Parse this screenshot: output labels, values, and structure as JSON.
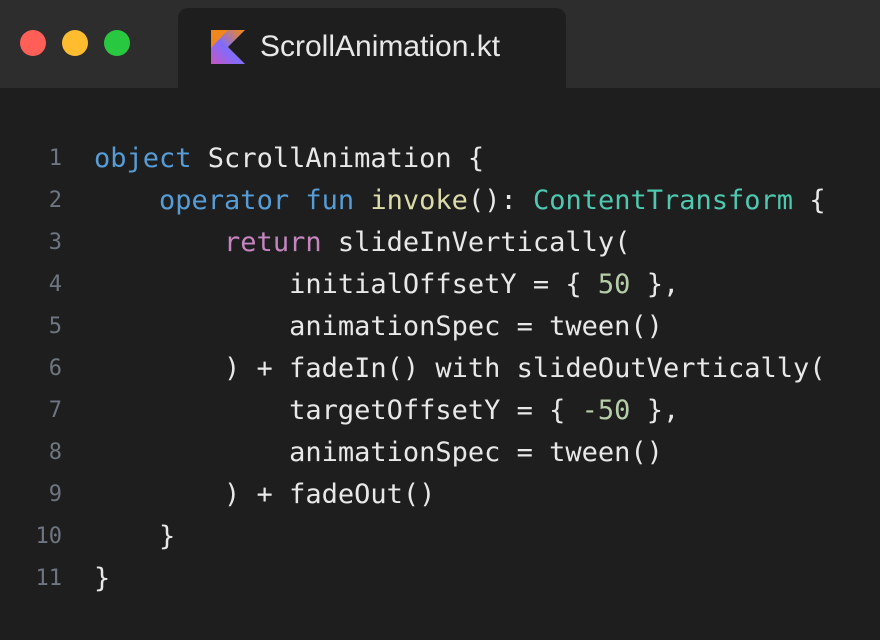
{
  "window": {
    "traffic_lights": [
      {
        "name": "close",
        "color": "#ff5f57"
      },
      {
        "name": "minimize",
        "color": "#febc2e"
      },
      {
        "name": "zoom",
        "color": "#28c840"
      }
    ]
  },
  "tab": {
    "icon": "kotlin-icon",
    "title": "ScrollAnimation.kt"
  },
  "colors": {
    "keyword": "#569cd6",
    "return_keyword": "#c586c0",
    "function": "#dcdcaa",
    "type": "#4ec9b0",
    "number": "#b5cea8",
    "plain": "#e8e8e8",
    "line_number": "#6e7681"
  },
  "code": {
    "lines": [
      {
        "number": "1",
        "tokens": [
          {
            "t": "object",
            "c": "kw"
          },
          {
            "t": " ScrollAnimation {",
            "c": "plain"
          }
        ]
      },
      {
        "number": "2",
        "tokens": [
          {
            "t": "    ",
            "c": "plain"
          },
          {
            "t": "operator",
            "c": "kw"
          },
          {
            "t": " ",
            "c": "plain"
          },
          {
            "t": "fun",
            "c": "kw"
          },
          {
            "t": " ",
            "c": "plain"
          },
          {
            "t": "invoke",
            "c": "fn"
          },
          {
            "t": "(): ",
            "c": "plain"
          },
          {
            "t": "ContentTransform",
            "c": "type"
          },
          {
            "t": " {",
            "c": "plain"
          }
        ]
      },
      {
        "number": "3",
        "tokens": [
          {
            "t": "        ",
            "c": "plain"
          },
          {
            "t": "return",
            "c": "ret"
          },
          {
            "t": " slideInVertically(",
            "c": "plain"
          }
        ]
      },
      {
        "number": "4",
        "tokens": [
          {
            "t": "            initialOffsetY = { ",
            "c": "plain"
          },
          {
            "t": "50",
            "c": "num"
          },
          {
            "t": " },",
            "c": "plain"
          }
        ]
      },
      {
        "number": "5",
        "tokens": [
          {
            "t": "            animationSpec = tween()",
            "c": "plain"
          }
        ]
      },
      {
        "number": "6",
        "tokens": [
          {
            "t": "        ) + fadeIn() with slideOutVertically(",
            "c": "plain"
          }
        ]
      },
      {
        "number": "7",
        "tokens": [
          {
            "t": "            targetOffsetY = { ",
            "c": "plain"
          },
          {
            "t": "-50",
            "c": "num"
          },
          {
            "t": " },",
            "c": "plain"
          }
        ]
      },
      {
        "number": "8",
        "tokens": [
          {
            "t": "            animationSpec = tween()",
            "c": "plain"
          }
        ]
      },
      {
        "number": "9",
        "tokens": [
          {
            "t": "        ) + fadeOut()",
            "c": "plain"
          }
        ]
      },
      {
        "number": "10",
        "tokens": [
          {
            "t": "    }",
            "c": "plain"
          }
        ]
      },
      {
        "number": "11",
        "tokens": [
          {
            "t": "}",
            "c": "plain"
          }
        ]
      }
    ]
  }
}
